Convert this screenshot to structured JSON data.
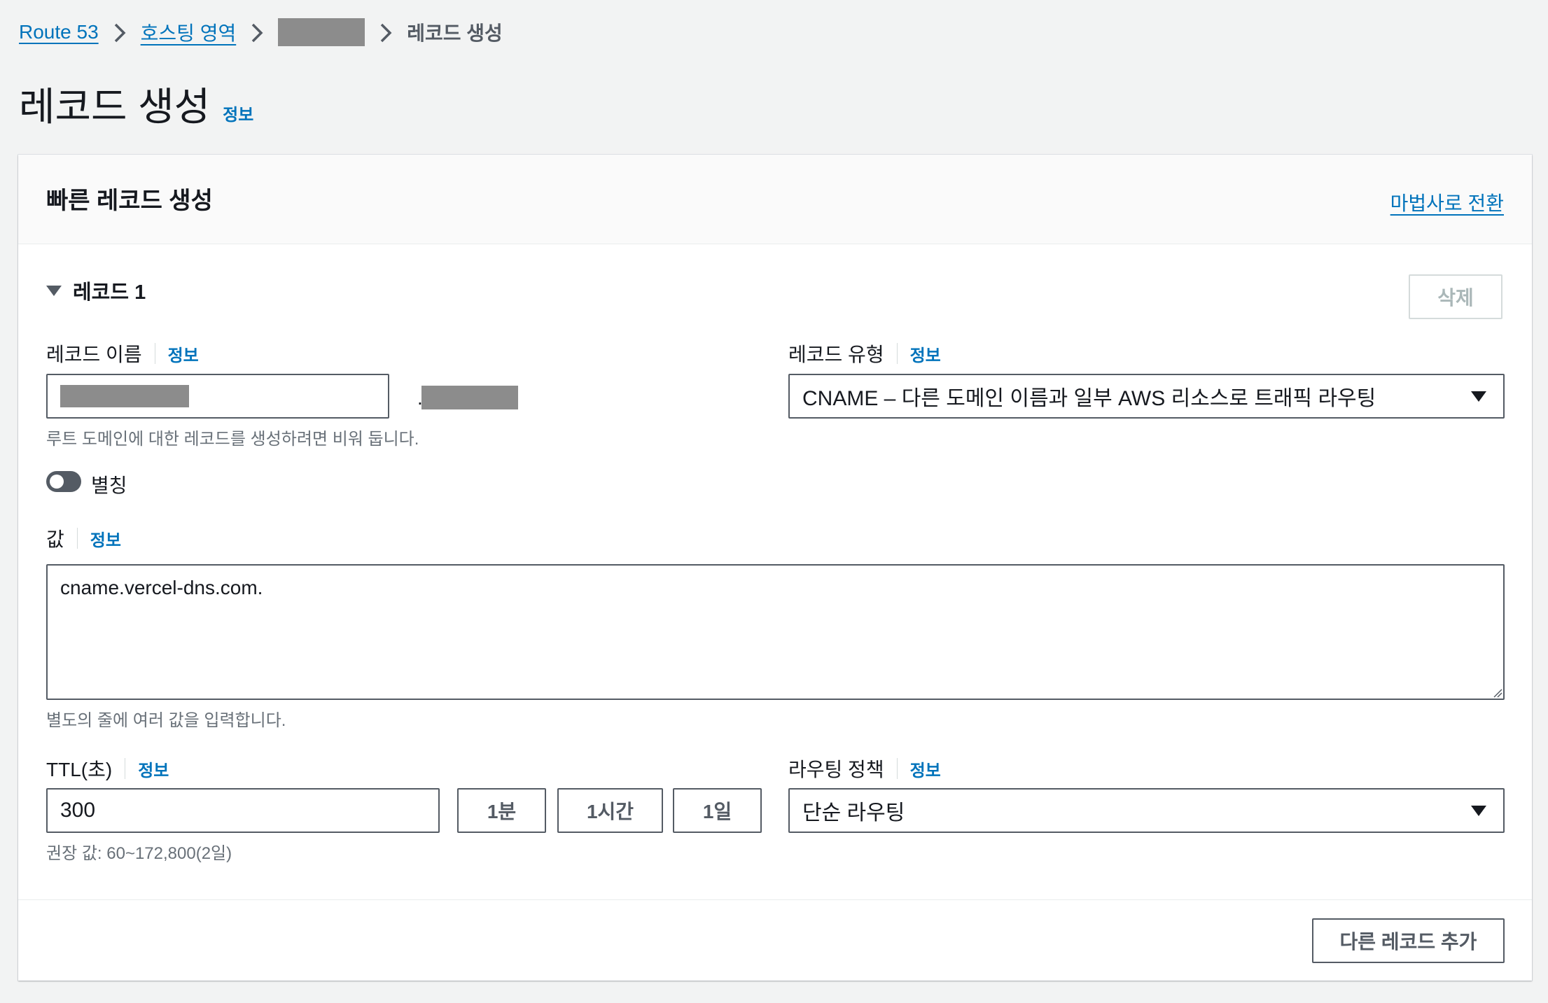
{
  "breadcrumb": {
    "items": [
      "Route 53",
      "호스팅 영역"
    ],
    "current": "레코드 생성"
  },
  "page": {
    "title": "레코드 생성",
    "info": "정보"
  },
  "panel": {
    "title": "빠른 레코드 생성",
    "wizard_link": "마법사로 전환"
  },
  "record": {
    "section_title": "레코드 1",
    "delete_label": "삭제",
    "name": {
      "label": "레코드 이름",
      "info": "정보",
      "dot": ".",
      "hint": "루트 도메인에 대한 레코드를 생성하려면 비워 둡니다."
    },
    "type": {
      "label": "레코드 유형",
      "info": "정보",
      "value": "CNAME – 다른 도메인 이름과 일부 AWS 리소스로 트래픽 라우팅"
    },
    "alias": {
      "label": "별칭",
      "enabled": false
    },
    "value": {
      "label": "값",
      "info": "정보",
      "text": "cname.vercel-dns.com.",
      "hint": "별도의 줄에 여러 값을 입력합니다."
    },
    "ttl": {
      "label": "TTL(초)",
      "info": "정보",
      "value": "300",
      "presets": [
        "1분",
        "1시간",
        "1일"
      ],
      "hint": "권장 값: 60~172,800(2일)"
    },
    "routing": {
      "label": "라우팅 정책",
      "info": "정보",
      "value": "단순 라우팅"
    }
  },
  "footer": {
    "add_record_label": "다른 레코드 추가"
  }
}
